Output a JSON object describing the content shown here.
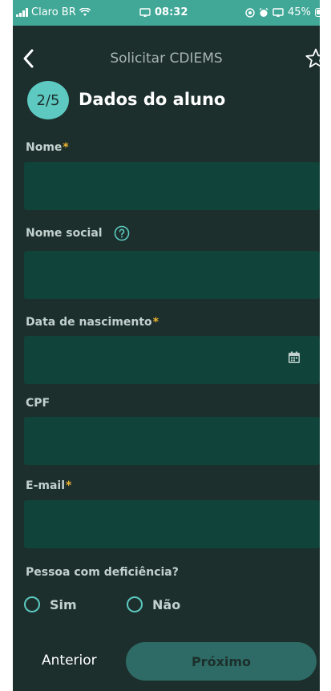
{
  "status_bar": {
    "carrier": "Claro BR",
    "time": "08:32",
    "battery": "45%"
  },
  "header": {
    "title": "Solicitar CDIEMS",
    "back_icon": "chevron-left-icon",
    "favorite_icon": "star-outline-icon"
  },
  "step": {
    "indicator": "2/5",
    "title": "Dados do aluno"
  },
  "form": {
    "nome": {
      "label": "Nome",
      "required_mark": "*",
      "value": ""
    },
    "nome_social": {
      "label": "Nome social",
      "value": "",
      "help_icon": "question-circle-icon"
    },
    "data_nascimento": {
      "label": "Data de nascimento",
      "required_mark": "*",
      "value": "",
      "icon": "calendar-icon"
    },
    "cpf": {
      "label": "CPF",
      "value": ""
    },
    "email": {
      "label": "E-mail",
      "required_mark": "*",
      "value": ""
    },
    "deficiencia": {
      "question": "Pessoa com deficiência?",
      "options": [
        {
          "label": "Sim",
          "selected": false
        },
        {
          "label": "Não",
          "selected": false
        }
      ]
    }
  },
  "footer": {
    "previous_label": "Anterior",
    "next_label": "Próximo"
  },
  "colors": {
    "background": "#1c2f2c",
    "status_bar": "#41a897",
    "input_bg": "#10443a",
    "accent": "#5dc9c0",
    "required": "#f0b430",
    "next_button": "#2f6b66"
  }
}
